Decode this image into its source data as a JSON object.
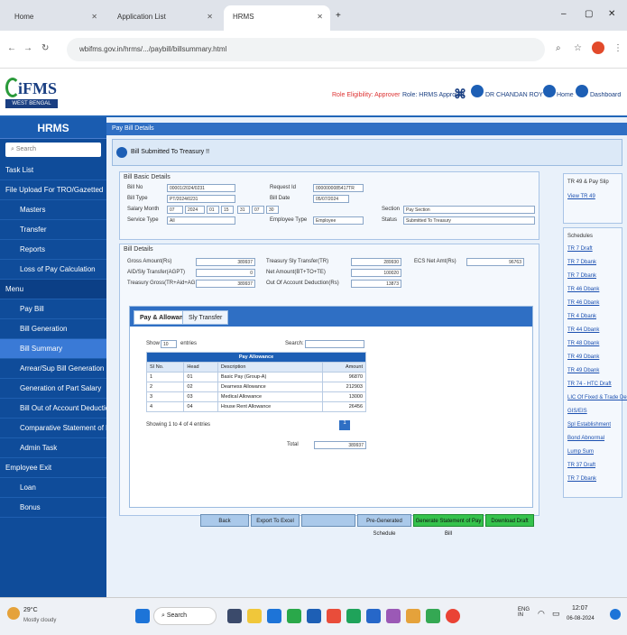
{
  "browser": {
    "tabs": [
      "Home",
      "Application List",
      "HRMS"
    ],
    "url": "wbifms.gov.in/hrms/.../paybill/billsummary.html",
    "new_tab": "+",
    "window_controls": [
      "–",
      "▢",
      "✕"
    ]
  },
  "header": {
    "logo_text": "iFMS",
    "logo_sub": "WEST BENGAL",
    "link_digital": "Role Eligibility: Approver",
    "link_role": "Role: HRMS Approver",
    "user": "DR CHANDAN ROY",
    "home": "Home",
    "dashboard": "Dashboard"
  },
  "sidebar": {
    "title": "HRMS",
    "search_placeholder": "Search",
    "items": [
      {
        "label": "Task List",
        "sub": false,
        "active": false
      },
      {
        "label": "File Upload For TRO/Gazetted",
        "sub": false,
        "active": false
      },
      {
        "label": "Masters",
        "sub": true,
        "active": false
      },
      {
        "label": "Transfer",
        "sub": true,
        "active": false
      },
      {
        "label": "Reports",
        "sub": true,
        "active": false
      },
      {
        "label": "Loss of Pay Calculation",
        "sub": true,
        "active": false
      },
      {
        "label": "Menu",
        "sub": false,
        "active": false,
        "hdr": true
      },
      {
        "label": "Pay Bill",
        "sub": true,
        "active": false
      },
      {
        "label": "Bill Generation",
        "sub": true,
        "active": false
      },
      {
        "label": "Bill Summary",
        "sub": true,
        "active": true
      },
      {
        "label": "Arrear/Sup Bill Generation",
        "sub": true,
        "active": false
      },
      {
        "label": "Generation of Part Salary",
        "sub": true,
        "active": false
      },
      {
        "label": "Bill Out of Account Deduction",
        "sub": true,
        "active": false
      },
      {
        "label": "Comparative Statement of Pay",
        "sub": true,
        "active": false
      },
      {
        "label": "Admin Task",
        "sub": true,
        "active": false
      },
      {
        "label": "Employee Exit",
        "sub": false,
        "active": false
      },
      {
        "label": "Loan",
        "sub": true,
        "active": false
      },
      {
        "label": "Bonus",
        "sub": true,
        "active": false
      }
    ]
  },
  "main": {
    "breadcrumb": "Pay Bill Details",
    "status": "Bill Submitted To Treasury !!",
    "basic": {
      "title": "Bill Basic Details",
      "bill_no_label": "Bill No",
      "bill_no": "00001/2024/0231",
      "bill_type_label": "Bill Type",
      "bill_type": "PT/2024/0231",
      "salary_month_label": "Salary Month",
      "salary_month": [
        "07",
        "2024",
        "01",
        "15",
        "31",
        "07",
        "30"
      ],
      "service_type_label": "Service Type",
      "service_type": "All",
      "request_id_label": "Request Id",
      "request_id": "0000000085417TR",
      "bill_date_label": "Bill Date",
      "bill_date": "05/07/2024",
      "employee_type_label": "Employee Type",
      "employee_type": "Employee",
      "section_label": "Section",
      "section": "Pay Section",
      "status_label": "Status",
      "status": "Submitted To Treasury"
    },
    "details": {
      "title": "Bill Details",
      "gross_label": "Gross Amount(Rs)",
      "gross": "389937",
      "aid_label": "AID/Sly Transfer(AGPT)",
      "aid": "0",
      "treasury_label": "Treasury Gross(TR+Aid+AGPT)",
      "treasury": "389937",
      "tds_label": "Treasury Sly Transfer(TR)",
      "tds": "289930",
      "net_label": "Net Amount(BT+TO+TE)",
      "net": "100020",
      "outside_label": "Out Of Account Deduction(Rs)",
      "outside": "13873",
      "ecs_label": "ECS Net Amt(Rs)",
      "ecs": "96763"
    },
    "tabs": [
      "Pay & Allowance",
      "Sly Transfer"
    ],
    "show_label": "Show",
    "show_value": "10",
    "entries_label": "entries",
    "search_label": "Search:",
    "table": {
      "title": "Pay Allowance",
      "columns": [
        "SI No.",
        "Head",
        "Description",
        "Amount"
      ],
      "rows": [
        [
          "1",
          "01",
          "Basic Pay (Group-A)",
          "96870"
        ],
        [
          "2",
          "02",
          "Dearness Allowance",
          "212903"
        ],
        [
          "3",
          "03",
          "Medical Allowance",
          "13000"
        ],
        [
          "4",
          "04",
          "House Rent Allowance",
          "26456"
        ]
      ],
      "footer": "Showing 1 to 4 of 4 entries",
      "page": "1",
      "total_label": "Total",
      "total": "389937"
    },
    "buttons": [
      "Back",
      "Export To Excel",
      "",
      "Pre-Generated Schedule",
      "Generate Statement of Pay Bill",
      "Download Draft"
    ]
  },
  "right": {
    "box1_title": "TR 49 & Pay Slip",
    "box1_link": "View TR 49",
    "box2_title": "Schedules",
    "links": [
      "TR 7 Draft",
      "TR 7 Dbank",
      "TR 7 Dbank",
      "TR 46 Dbank",
      "TR 46 Dbank",
      "TR 4 Dbank",
      "TR 44 Dbank",
      "TR 48 Dbank",
      "TR 49 Dbank",
      "TR 49 Dbank",
      "TR 74 - HTC Draft",
      "LIC Of Fixed & Trade Deduction",
      "GIS/EIS",
      "Spl Establishment",
      "Bond Abnormal",
      "Lump Sum",
      "TR 37 Draft",
      "TR 7 Dbank"
    ]
  },
  "taskbar": {
    "weather_temp": "29°C",
    "weather_text": "Mostly cloudy",
    "search_label": "Search",
    "lang": "ENG IN",
    "time": "12:07",
    "date": "06-08-2024"
  }
}
